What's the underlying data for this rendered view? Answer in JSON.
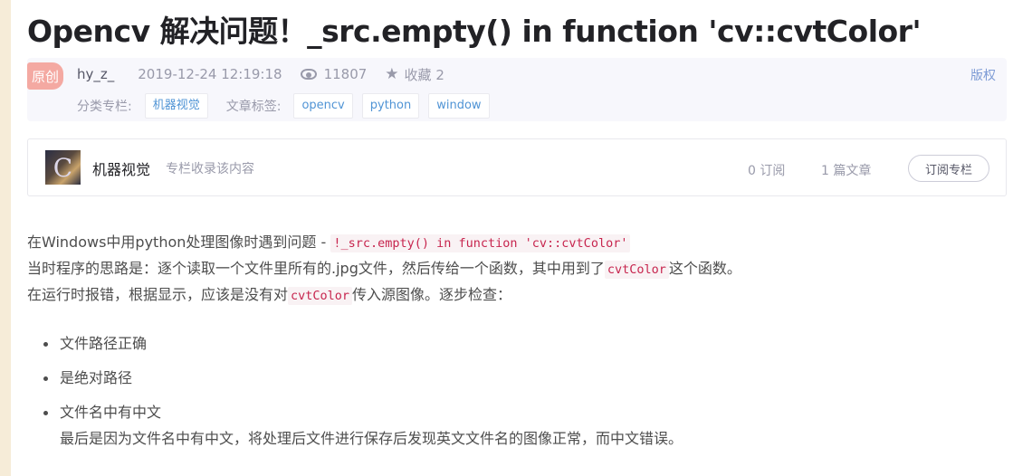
{
  "article": {
    "title": "Opencv 解决问题！_src.empty() in function 'cv::cvtColor'",
    "badge": "原创",
    "author": "hy_z_",
    "date": "2019-12-24 12:19:18",
    "views": "11807",
    "favorites": "收藏 2",
    "copyright": "版权",
    "category_label": "分类专栏:",
    "categories": [
      "机器视觉"
    ],
    "tags_label": "文章标签:",
    "tags": [
      "opencv",
      "python",
      "window"
    ]
  },
  "column": {
    "thumb_letter": "C",
    "name": "机器视觉",
    "desc": "专栏收录该内容",
    "subscribers": "0 订阅",
    "articles": "1 篇文章",
    "subscribe_label": "订阅专栏"
  },
  "body": {
    "p1_text": "在Windows中用python处理图像时遇到问题 - ",
    "p1_code": "!_src.empty() in function 'cv::cvtColor'",
    "p2_text_a": "当时程序的思路是：逐个读取一个文件里所有的.jpg文件，然后传给一个函数，其中用到了",
    "p2_code": "cvtColor",
    "p2_text_b": "这个函数。",
    "p3_text_a": "在运行时报错，根据显示，应该是没有对",
    "p3_code": "cvtColor",
    "p3_text_b": "传入源图像。逐步检查：",
    "list": [
      "文件路径正确",
      "是绝对路径",
      "文件名中有中文"
    ],
    "conclusion": "最后是因为文件名中有中文，将处理后文件进行保存后发现英文文件名的图像正常，而中文错误。"
  },
  "colors": {
    "accent": "#5094d5",
    "code": "#c7254e",
    "badge": "#f4a9a2"
  },
  "icons": [
    "eye-icon",
    "star-icon"
  ]
}
